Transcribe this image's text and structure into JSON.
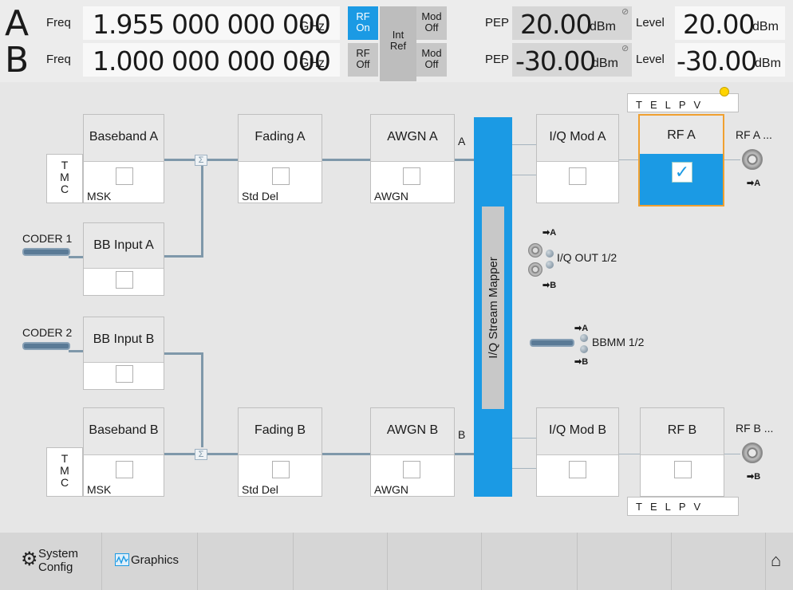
{
  "header": {
    "a": {
      "letter": "A",
      "freq_label": "Freq",
      "freq_value": "1.955 000 000 000",
      "freq_unit": "GHz",
      "rf_line1": "RF",
      "rf_line2": "On",
      "mod_line1": "Mod",
      "mod_line2": "Off",
      "pep_label": "PEP",
      "pep_value": "20.00",
      "pep_unit": "dBm",
      "level_label": "Level",
      "level_value": "20.00",
      "level_unit": "dBm"
    },
    "b": {
      "letter": "B",
      "freq_label": "Freq",
      "freq_value": "1.000 000 000 000",
      "freq_unit": "GHz",
      "rf_line1": "RF",
      "rf_line2": "Off",
      "mod_line1": "Mod",
      "mod_line2": "Off",
      "pep_label": "PEP",
      "pep_value": "-30.00",
      "pep_unit": "dBm",
      "level_label": "Level",
      "level_value": "-30.00",
      "level_unit": "dBm"
    },
    "ref_line1": "Int",
    "ref_line2": "Ref",
    "colors": {
      "rf_on": "#1b9ae4",
      "rf_off": "#c7c7c7"
    }
  },
  "diagram": {
    "baseband_a": {
      "title": "Baseband A",
      "value": "MSK"
    },
    "baseband_b": {
      "title": "Baseband B",
      "value": "MSK"
    },
    "fading_a": {
      "title": "Fading A",
      "value": "Std Del"
    },
    "fading_b": {
      "title": "Fading B",
      "value": "Std Del"
    },
    "awgn_a": {
      "title": "AWGN A",
      "value": "AWGN"
    },
    "awgn_b": {
      "title": "AWGN B",
      "value": "AWGN"
    },
    "iqmod_a": {
      "title": "I/Q Mod A"
    },
    "iqmod_b": {
      "title": "I/Q Mod B"
    },
    "rf_a": {
      "title": "RF A"
    },
    "rf_b": {
      "title": "RF B"
    },
    "bbinput_a": {
      "title": "BB Input A"
    },
    "bbinput_b": {
      "title": "BB Input B"
    },
    "tmc": {
      "t": "T",
      "m": "M",
      "c": "C"
    },
    "coder1": "CODER 1",
    "coder2": "CODER 2",
    "sigma": "Σ",
    "stream_mapper": "I/Q Stream Mapper",
    "path_a": "A",
    "path_b": "B",
    "rf_a_out": "RF A ...",
    "rf_b_out": "RF B ...",
    "out_a": "➡A",
    "out_b": "➡B",
    "iq_out": "I/Q OUT 1/2",
    "bbmm": "BBMM 1/2",
    "telpv": "TELPV",
    "check": "✓",
    "accent": "#1b9ae4",
    "focus": "#f0a030"
  },
  "footer": {
    "system_line1": "System",
    "system_line2": "Config",
    "graphics": "Graphics",
    "home_icon": "⌂"
  }
}
